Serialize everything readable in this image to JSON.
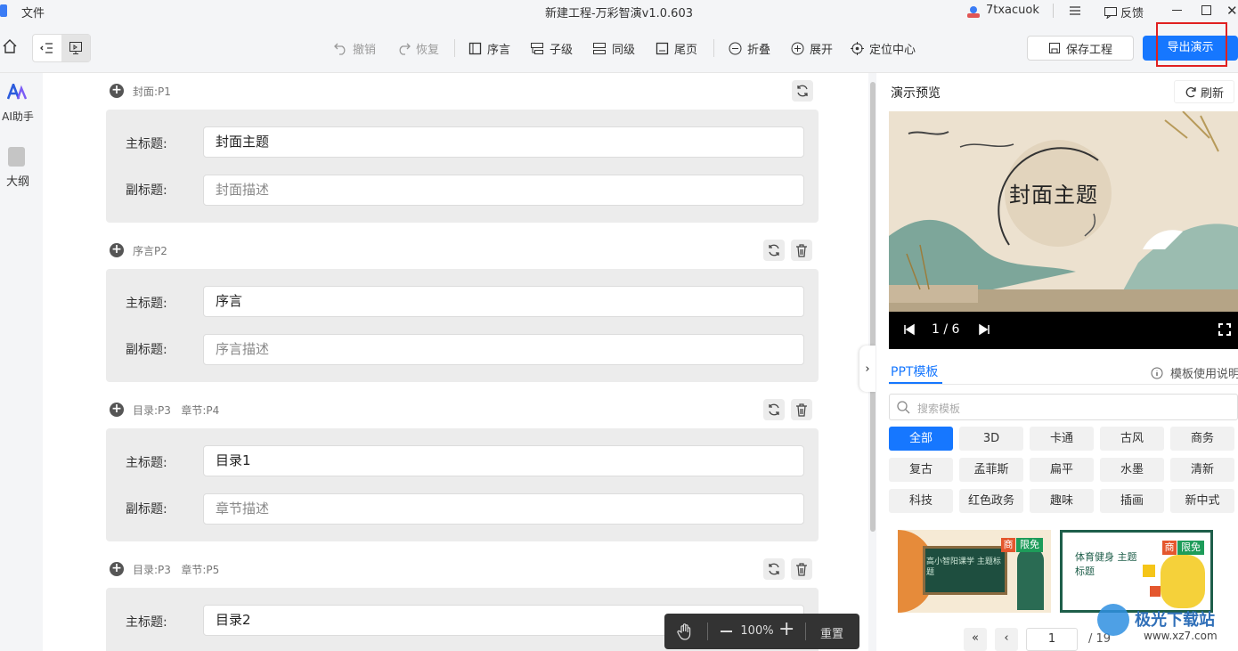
{
  "window": {
    "menu_file": "文件",
    "title": "新建工程-万彩智演v1.0.603",
    "username": "7txacuok",
    "feedback": "反馈"
  },
  "toolbar": {
    "undo": "撤销",
    "redo": "恢复",
    "preface": "序言",
    "child": "子级",
    "sibling": "同级",
    "last_page": "尾页",
    "collapse": "折叠",
    "expand": "展开",
    "locate_center": "定位中心",
    "save_project": "保存工程",
    "export": "导出演示"
  },
  "leftnav": {
    "ai_label": "AI助手",
    "outline_label": "大纲"
  },
  "editor": {
    "main_title_label": "主标题:",
    "subtitle_label": "副标题:",
    "sections": [
      {
        "head": "封面:P1",
        "title": "封面主题",
        "subtitle_placeholder": "封面描述"
      },
      {
        "head": "序言P2",
        "title": "序言",
        "subtitle_placeholder": "序言描述"
      },
      {
        "head": "目录:P3   章节:P4",
        "title": "目录1",
        "subtitle_placeholder": "章节描述"
      },
      {
        "head": "目录:P3   章节:P5",
        "title": "目录2"
      }
    ],
    "zoom": "100%",
    "reset": "重置"
  },
  "preview": {
    "title": "演示预览",
    "refresh": "刷新",
    "slide_title": "封面主题",
    "page": "1 / 6",
    "tab_label": "PPT模板",
    "template_help": "模板使用说明",
    "search_placeholder": "搜索模板",
    "categories": [
      "全部",
      "3D",
      "卡通",
      "古风",
      "商务",
      "复古",
      "孟菲斯",
      "扁平",
      "水墨",
      "清新",
      "科技",
      "红色政务",
      "趣味",
      "插画",
      "新中式"
    ],
    "active_category": "全部",
    "thumb1": {
      "text": "高小智阳课学 主题标题",
      "badge_shop": "商",
      "badge_free": "限免"
    },
    "thumb2": {
      "text": "体育健身 主题标题",
      "badge_shop": "商",
      "badge_free": "限免"
    },
    "pager_current": "1",
    "pager_total": "/ 19",
    "watermark": "极光下载站",
    "watermark_url": "www.xz7.com"
  },
  "colors": {
    "accent": "#1677ff",
    "highlight_box": "#e02020"
  }
}
